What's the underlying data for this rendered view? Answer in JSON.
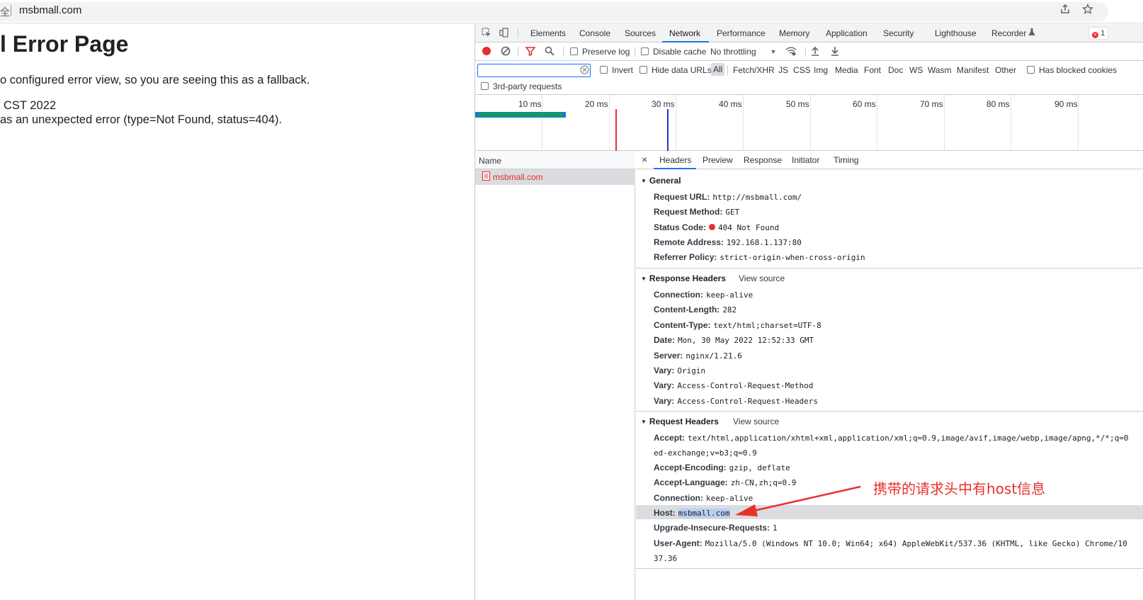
{
  "address_bar": {
    "security_label": "全",
    "url": "msbmall.com",
    "share_icon": "share-icon",
    "bookmark_icon": "star-icon"
  },
  "page": {
    "title": "l Error Page",
    "line1": "o configured error view, so you are seeing this as a fallback.",
    "line2": "CST 2022",
    "line3": "as an unexpected error (type=Not Found, status=404)."
  },
  "devtools": {
    "tabs": [
      "Elements",
      "Console",
      "Sources",
      "Network",
      "Performance",
      "Memory",
      "Application",
      "Security",
      "Lighthouse",
      "Recorder"
    ],
    "active_tab": "Network",
    "error_count": "1",
    "toolbar": {
      "preserve_log": "Preserve log",
      "disable_cache": "Disable cache",
      "throttling": "No throttling"
    },
    "filter": {
      "placeholder": "",
      "invert": "Invert",
      "hide_data_urls": "Hide data URLs",
      "types": [
        "All",
        "Fetch/XHR",
        "JS",
        "CSS",
        "Img",
        "Media",
        "Font",
        "Doc",
        "WS",
        "Wasm",
        "Manifest",
        "Other"
      ],
      "has_blocked_cookies": "Has blocked cookies",
      "third_party": "3rd-party requests"
    },
    "overview": {
      "ticks": [
        "10 ms",
        "20 ms",
        "30 ms",
        "40 ms",
        "50 ms",
        "60 ms",
        "70 ms",
        "80 ms",
        "90 ms"
      ]
    },
    "list": {
      "column": "Name",
      "items": [
        "msbmall.com"
      ]
    },
    "detail": {
      "close": "×",
      "tabs": [
        "Headers",
        "Preview",
        "Response",
        "Initiator",
        "Timing"
      ],
      "active_tab": "Headers",
      "general": {
        "title": "General",
        "rows": [
          {
            "k": "Request URL:",
            "v": "http://msbmall.com/"
          },
          {
            "k": "Request Method:",
            "v": "GET"
          },
          {
            "k": "Status Code:",
            "v": "404 Not Found"
          },
          {
            "k": "Remote Address:",
            "v": "192.168.1.137:80"
          },
          {
            "k": "Referrer Policy:",
            "v": "strict-origin-when-cross-origin"
          }
        ]
      },
      "response_headers": {
        "title": "Response Headers",
        "view_source": "View source",
        "rows": [
          {
            "k": "Connection:",
            "v": "keep-alive"
          },
          {
            "k": "Content-Length:",
            "v": "282"
          },
          {
            "k": "Content-Type:",
            "v": "text/html;charset=UTF-8"
          },
          {
            "k": "Date:",
            "v": "Mon, 30 May 2022 12:52:33 GMT"
          },
          {
            "k": "Server:",
            "v": "nginx/1.21.6"
          },
          {
            "k": "Vary:",
            "v": "Origin"
          },
          {
            "k": "Vary:",
            "v": "Access-Control-Request-Method"
          },
          {
            "k": "Vary:",
            "v": "Access-Control-Request-Headers"
          }
        ]
      },
      "request_headers": {
        "title": "Request Headers",
        "view_source": "View source",
        "accept_k": "Accept:",
        "accept_v": "text/html,application/xhtml+xml,application/xml;q=0.9,image/avif,image/webp,image/apng,*/*;q=0",
        "accept_cont": "ed-exchange;v=b3;q=0.9",
        "encoding_k": "Accept-Encoding:",
        "encoding_v": "gzip, deflate",
        "language_k": "Accept-Language:",
        "language_v": "zh-CN,zh;q=0.9",
        "connection_k": "Connection:",
        "connection_v": "keep-alive",
        "host_k": "Host:",
        "host_v": "msbmall.com",
        "upgrade_k": "Upgrade-Insecure-Requests:",
        "upgrade_v": "1",
        "ua_k": "User-Agent:",
        "ua_v": "Mozilla/5.0 (Windows NT 10.0; Win64; x64) AppleWebKit/537.36 (KHTML, like Gecko) Chrome/10",
        "ua_cont": "37.36"
      }
    }
  },
  "annotation": {
    "text": "携带的请求头中有host信息",
    "color": "#e8312a"
  }
}
